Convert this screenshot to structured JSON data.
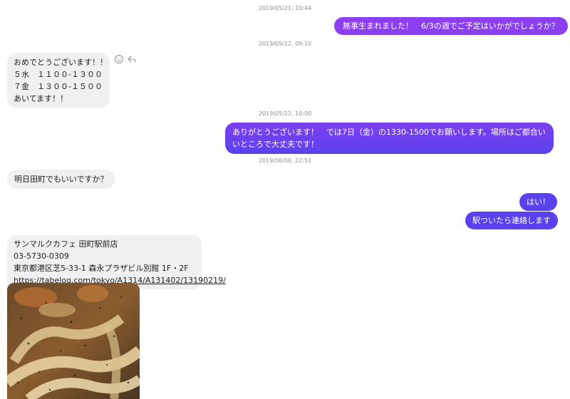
{
  "colors": {
    "outgoing_top": "#9a3ff0",
    "outgoing_bottom": "#5a41ee",
    "incoming_bg": "#f0f0f0",
    "timestamp": "#8e8e93"
  },
  "timestamps": [
    "2019/05/21, 10:44",
    "2019/05/22, 09:10",
    "2019/05/22, 10:00",
    "2019/06/06, 22:51"
  ],
  "messages": {
    "m1": {
      "text": "無事生まれました！　6/3の週でご予定はいかがでしょうか？"
    },
    "m2": {
      "lines": [
        "おめでとうございます！！",
        "５水　１１００-１３００",
        "７金　１３００-１５００",
        "あいてます！！"
      ]
    },
    "m3": {
      "text": "ありがとうございます！　では7日（金）の1330-1500でお願いします。場所はご都合いいところで大丈夫です！"
    },
    "m4": {
      "text": "明日田町でもいいですか？"
    },
    "m5": {
      "text": "はい！"
    },
    "m6": {
      "text": "駅ついたら連絡します"
    },
    "m7": {
      "name": "サンマルクカフェ 田町駅前店",
      "phone": "03-5730-0309",
      "address": "東京都港区芝5-33-1 森永プラザビル別館 1F・2F",
      "url": "https://tabelog.com/tokyo/A1314/A131402/13190219/"
    }
  },
  "icons": {
    "react": "smiley-icon",
    "reply": "reply-icon"
  }
}
